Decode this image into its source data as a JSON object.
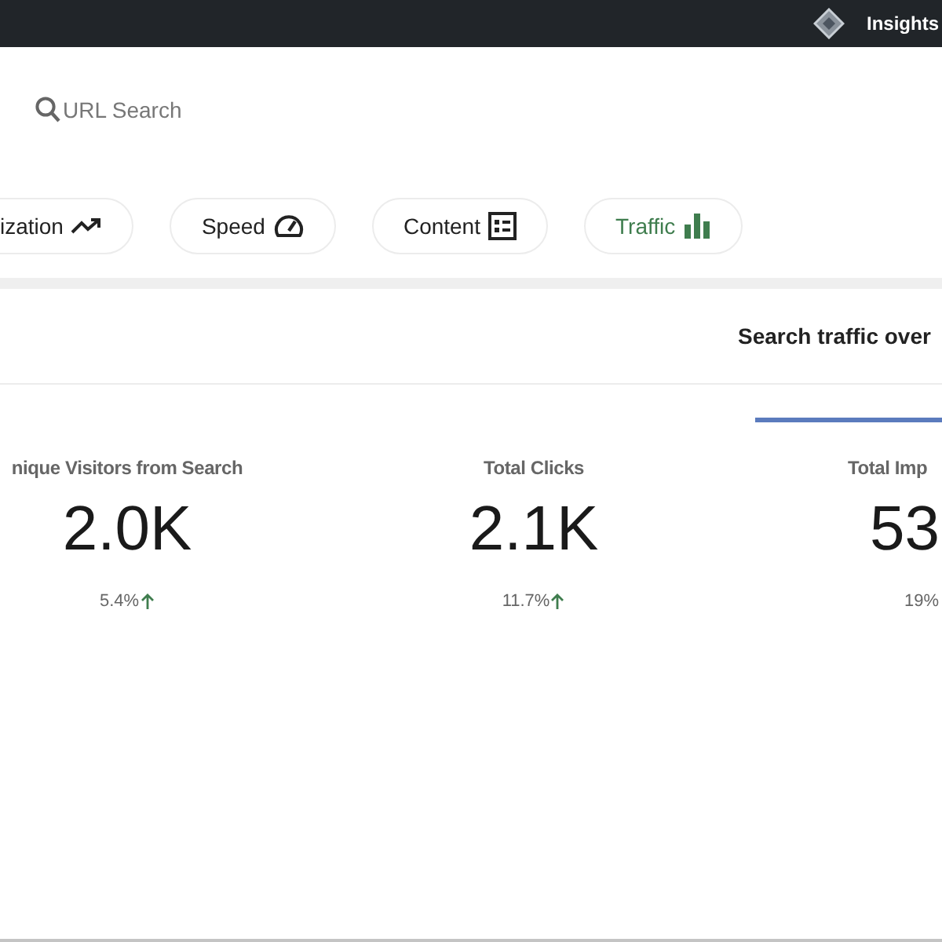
{
  "top_bar": {
    "title": "Insights"
  },
  "search": {
    "placeholder": "URL Search"
  },
  "tabs": [
    {
      "label": "ization",
      "selected": false
    },
    {
      "label": "Speed",
      "selected": false
    },
    {
      "label": "Content",
      "selected": false
    },
    {
      "label": "Traffic",
      "selected": true
    }
  ],
  "section": {
    "title": "Search traffic over"
  },
  "metrics": [
    {
      "label": "nique Visitors from Search",
      "value": "2.0K",
      "change": "5.4%",
      "rising": true
    },
    {
      "label": "Total Clicks",
      "value": "2.1K",
      "change": "11.7%",
      "rising": true
    },
    {
      "label": "Total Imp",
      "value": "53",
      "change": "19%",
      "rising": false
    }
  ]
}
